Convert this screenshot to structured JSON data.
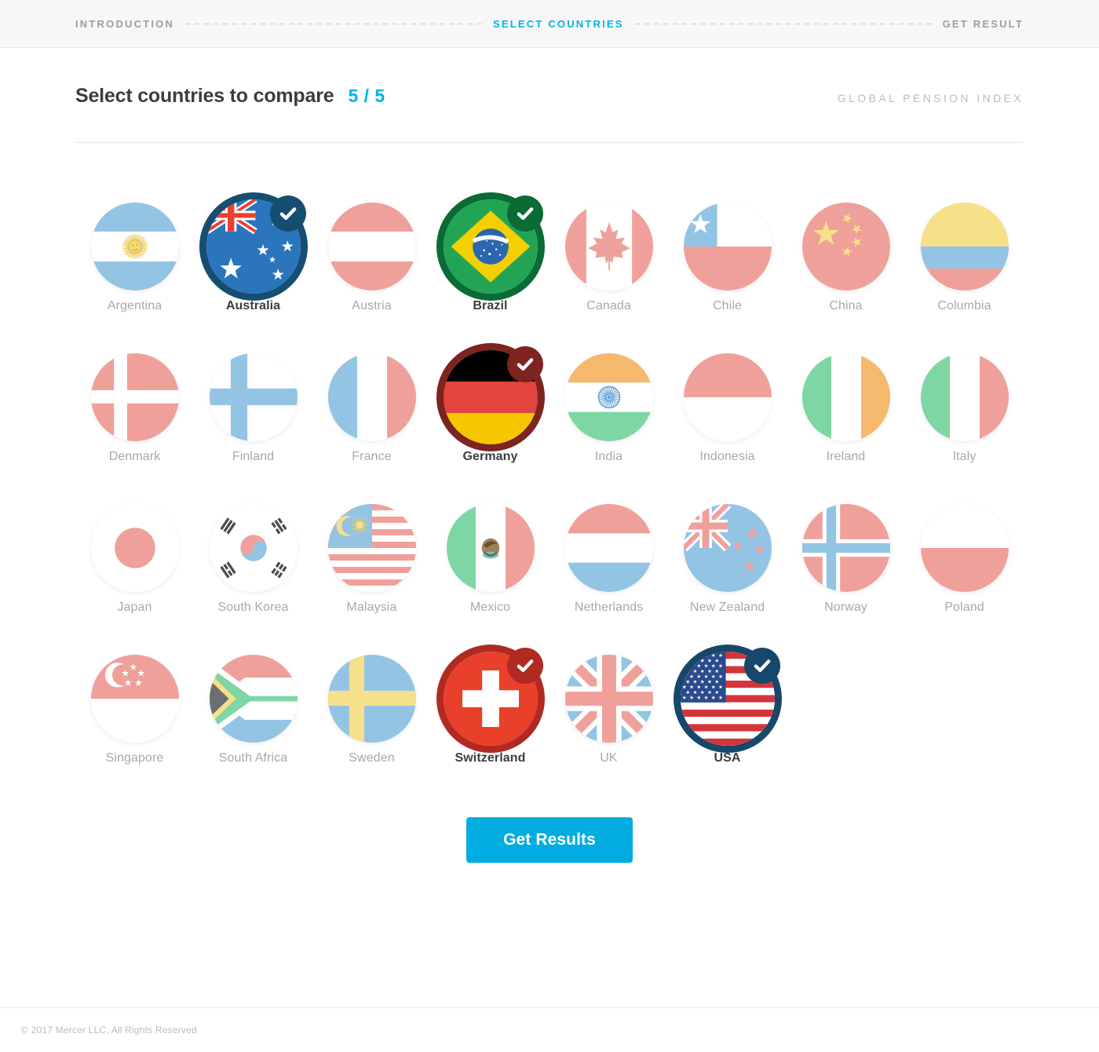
{
  "breadcrumb": {
    "steps": [
      {
        "label": "INTRODUCTION",
        "active": false
      },
      {
        "label": "SELECT COUNTRIES",
        "active": true
      },
      {
        "label": "GET RESULT",
        "active": false
      }
    ]
  },
  "header": {
    "title": "Select countries to compare",
    "counter": "5 / 5",
    "selected_count": 5,
    "max_count": 5,
    "brand": "GLOBAL PENSION INDEX"
  },
  "colors": {
    "accent": "#00b3e3",
    "button": "#00ace0",
    "label_muted": "#a6a9ab",
    "label_selected": "#3b3d3f",
    "pastel_red": "#f0a09a",
    "pastel_blue": "#93c4e4",
    "pastel_green": "#7ed6a5",
    "pastel_yellow": "#f7e08a",
    "pastel_orange": "#f5b96e",
    "pastel_gray": "#6d6e71"
  },
  "countries": [
    {
      "name": "Argentina",
      "flag": "argentina",
      "selected": false,
      "ring": "#5b9bd5"
    },
    {
      "name": "Australia",
      "flag": "australia",
      "selected": true,
      "ring": "#164e72"
    },
    {
      "name": "Austria",
      "flag": "austria",
      "selected": false,
      "ring": "#9c2a2a"
    },
    {
      "name": "Brazil",
      "flag": "brazil",
      "selected": true,
      "ring": "#0a6b35"
    },
    {
      "name": "Canada",
      "flag": "canada",
      "selected": false,
      "ring": "#9c2a2a"
    },
    {
      "name": "Chile",
      "flag": "chile",
      "selected": false,
      "ring": "#164e72"
    },
    {
      "name": "China",
      "flag": "china",
      "selected": false,
      "ring": "#9c2a2a"
    },
    {
      "name": "Columbia",
      "flag": "columbia",
      "selected": false,
      "ring": "#b79b20"
    },
    {
      "name": "Denmark",
      "flag": "denmark",
      "selected": false,
      "ring": "#9c2a2a"
    },
    {
      "name": "Finland",
      "flag": "finland",
      "selected": false,
      "ring": "#164e72"
    },
    {
      "name": "France",
      "flag": "france",
      "selected": false,
      "ring": "#164e72"
    },
    {
      "name": "Germany",
      "flag": "germany",
      "selected": true,
      "ring": "#7d2320"
    },
    {
      "name": "India",
      "flag": "india",
      "selected": false,
      "ring": "#c4761f"
    },
    {
      "name": "Indonesia",
      "flag": "indonesia",
      "selected": false,
      "ring": "#9c2a2a"
    },
    {
      "name": "Ireland",
      "flag": "ireland",
      "selected": false,
      "ring": "#0a6b35"
    },
    {
      "name": "Italy",
      "flag": "italy",
      "selected": false,
      "ring": "#0a6b35"
    },
    {
      "name": "Japan",
      "flag": "japan",
      "selected": false,
      "ring": "#9c2a2a"
    },
    {
      "name": "South Korea",
      "flag": "southkorea",
      "selected": false,
      "ring": "#164e72"
    },
    {
      "name": "Malaysia",
      "flag": "malaysia",
      "selected": false,
      "ring": "#164e72"
    },
    {
      "name": "Mexico",
      "flag": "mexico",
      "selected": false,
      "ring": "#0a6b35"
    },
    {
      "name": "Netherlands",
      "flag": "netherlands",
      "selected": false,
      "ring": "#9c2a2a"
    },
    {
      "name": "New Zealand",
      "flag": "newzealand",
      "selected": false,
      "ring": "#164e72"
    },
    {
      "name": "Norway",
      "flag": "norway",
      "selected": false,
      "ring": "#9c2a2a"
    },
    {
      "name": "Poland",
      "flag": "poland",
      "selected": false,
      "ring": "#9c2a2a"
    },
    {
      "name": "Singapore",
      "flag": "singapore",
      "selected": false,
      "ring": "#9c2a2a"
    },
    {
      "name": "South Africa",
      "flag": "southafrica",
      "selected": false,
      "ring": "#0a6b35"
    },
    {
      "name": "Sweden",
      "flag": "sweden",
      "selected": false,
      "ring": "#164e72"
    },
    {
      "name": "Switzerland",
      "flag": "switzerland",
      "selected": true,
      "ring": "#b02a22"
    },
    {
      "name": "UK",
      "flag": "uk",
      "selected": false,
      "ring": "#164e72"
    },
    {
      "name": "USA",
      "flag": "usa",
      "selected": true,
      "ring": "#17476b"
    }
  ],
  "actions": {
    "get_results_label": "Get Results"
  },
  "footer": {
    "copyright": "© 2017 Mercer LLC, All Rights Reserved"
  }
}
